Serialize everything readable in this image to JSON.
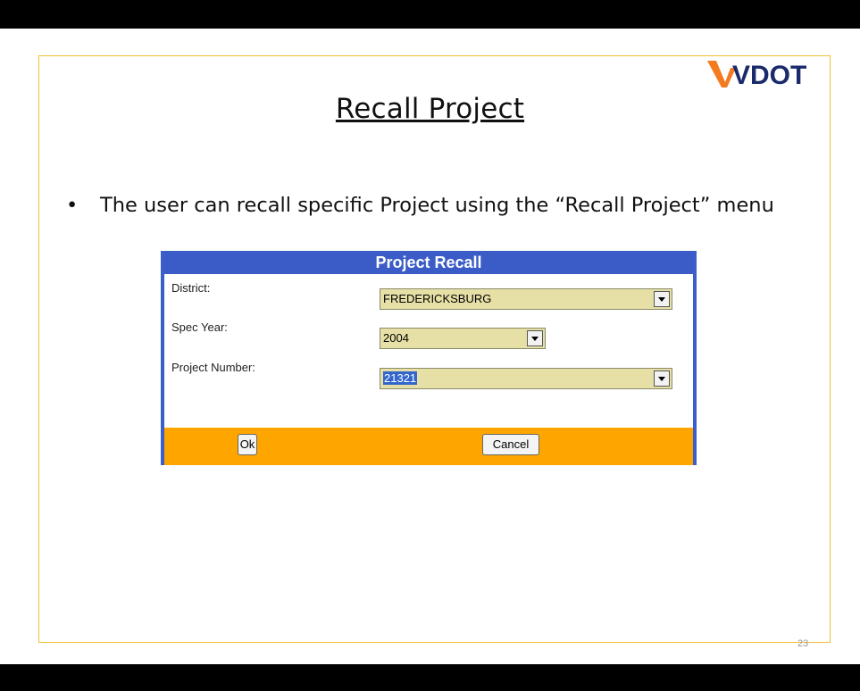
{
  "slide": {
    "logo_text": "VDOT",
    "title": "Recall Project",
    "bullet_symbol": "•",
    "bullet_text": "The user can recall specific Project using the “Recall Project” menu",
    "page_number": "23",
    "colors": {
      "border": "#f0c030",
      "logo_orange": "#f47a20",
      "logo_navy": "#1b2a6b"
    }
  },
  "dialog": {
    "title": "Project Recall",
    "fields": [
      {
        "label": "District:",
        "value": "FREDERICKSBURG"
      },
      {
        "label": "Spec Year:",
        "value": "2004"
      },
      {
        "label": "Project Number:",
        "value": "21321"
      }
    ],
    "ok_label": "Ok",
    "cancel_label": "Cancel",
    "colors": {
      "header": "#3b5cc6",
      "footer": "#ffa500",
      "select_bg": "#e6e0a6"
    }
  }
}
